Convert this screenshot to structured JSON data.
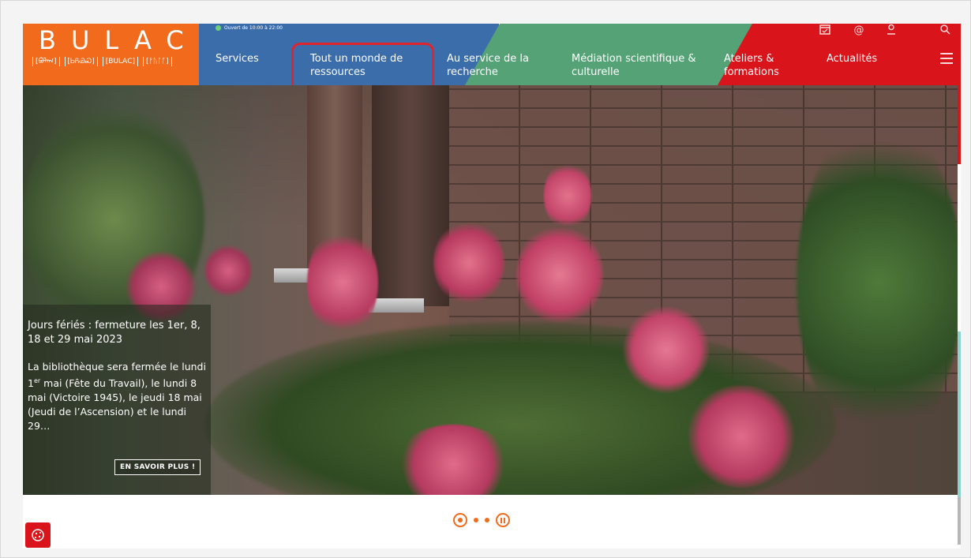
{
  "header": {
    "logo": {
      "text": "BULAC",
      "scripts": [
        "[ᠪᠤᠯᠠᠭ]",
        "[ᏏᏲᏯᏍ]",
        "[ꓐꓴꓡꓮꓚ]",
        "[ᚠᚢᛚᚪ]"
      ]
    },
    "opening_hours": "Ouvert de 10:00 à 22:00",
    "nav": {
      "services": "Services",
      "ressources_line1": "Tout un monde de",
      "ressources_line2": "ressources",
      "recherche_line1": "Au service de la",
      "recherche_line2": "recherche",
      "mediation_line1": "Médiation scientifique &",
      "mediation_line2": "culturelle",
      "ateliers_line1": "Ateliers &",
      "ateliers_line2": "formations",
      "actualites": "Actualités"
    },
    "utility_icons": [
      "calendar-icon",
      "at-icon",
      "user-icon",
      "search-icon",
      "menu-icon"
    ]
  },
  "hero": {
    "news": {
      "title": "Jours fériés : fermeture les 1er, 8, 18 et 29 mai 2023",
      "body_prefix": "La bibliothèque sera fermée le lundi 1",
      "body_sup": "er",
      "body_suffix": " mai (Fête du Travail), le lundi 8 mai (Victoire 1945), le jeudi 18 mai (Jeudi de l’Ascension) et le lundi 29…",
      "cta": "EN SAVOIR PLUS !"
    }
  },
  "carousel": {
    "slides": 3,
    "active_index": 0,
    "pause_label": "pause"
  },
  "colors": {
    "orange": "#f26a1b",
    "blue": "#3c6dab",
    "green": "#55a277",
    "red": "#d9141b",
    "highlight": "#e0242c"
  }
}
